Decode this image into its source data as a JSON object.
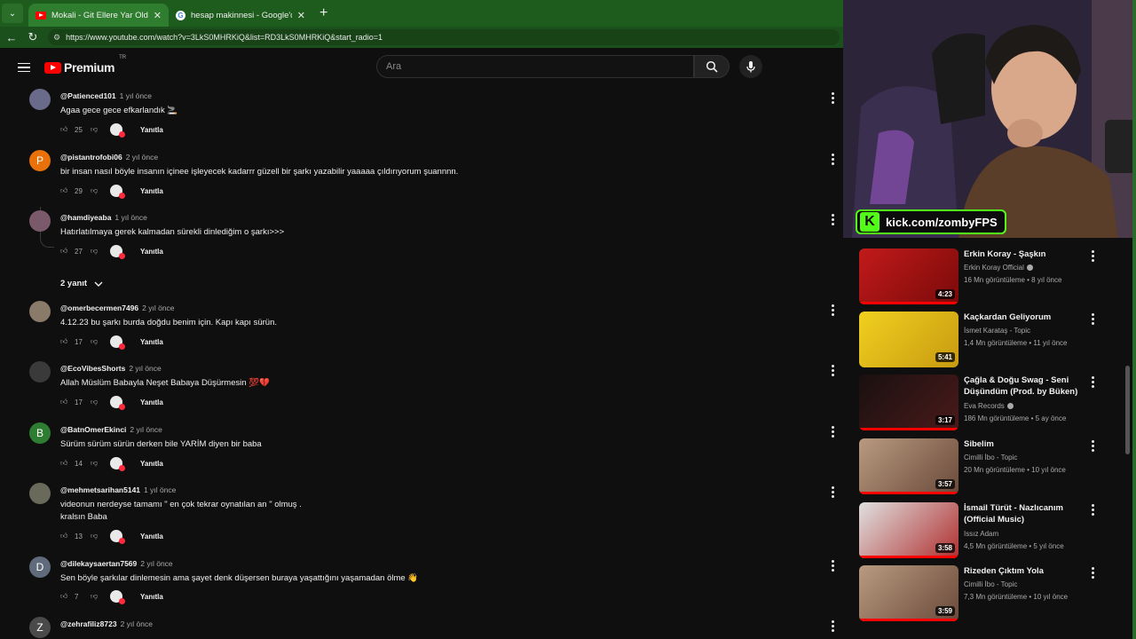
{
  "browser": {
    "tabs": [
      {
        "label": "Mokali - Git Ellere Yar Olda Git #bi",
        "active": true
      },
      {
        "label": "hesap makinnesi - Google'da Ara",
        "active": false
      }
    ],
    "new_tab": "+",
    "url": "https://www.youtube.com/watch?v=3LkS0MHRKiQ&list=RD3LkS0MHRKiQ&start_radio=1"
  },
  "youtube": {
    "logo_text": "Premium",
    "region": "TR",
    "search_placeholder": "Ara"
  },
  "comments": [
    {
      "author": "@Patienced101",
      "time": "1 yıl önce",
      "text": "Agaa gece gece efkarlandık 🚬",
      "likes": "25",
      "reply": "Yanıtla",
      "avatar_letter": "",
      "avatar_color": "#6a6a8a"
    },
    {
      "author": "@pistantrofobi06",
      "time": "2 yıl önce",
      "text": "bir insan nasıl böyle insanın içinee işleyecek kadarrr güzell bir şarkı yazabilir yaaaaa çıldırıyorum şuannnn.",
      "likes": "29",
      "reply": "Yanıtla",
      "avatar_letter": "P",
      "avatar_color": "#e8710a"
    },
    {
      "author": "@hamdiyeaba",
      "time": "1 yıl önce",
      "text": "Hatırlatılmaya gerek kalmadan sürekli dinlediğim o şarkı>>>",
      "likes": "27",
      "reply": "Yanıtla",
      "avatar_letter": "",
      "avatar_color": "#7a5a6a"
    },
    {
      "author": "@omerbecermen7496",
      "time": "2 yıl önce",
      "text": "4.12.23 bu şarkı burda doğdu benim için. Kapı kapı sürün.",
      "likes": "17",
      "reply": "Yanıtla",
      "avatar_letter": "",
      "avatar_color": "#8a7a6a"
    },
    {
      "author": "@EcoVibesShorts",
      "time": "2 yıl önce",
      "text": "Allah Müslüm Babayla Neşet Babaya Düşürmesin 💯💔",
      "likes": "17",
      "reply": "Yanıtla",
      "avatar_letter": "",
      "avatar_color": "#3a3a3a"
    },
    {
      "author": "@BatnOmerEkinci",
      "time": "2 yıl önce",
      "text": "Sürüm sürüm sürün derken bile YARİM diyen bir baba",
      "likes": "14",
      "reply": "Yanıtla",
      "avatar_letter": "B",
      "avatar_color": "#2e7d32"
    },
    {
      "author": "@mehmetsarihan5141",
      "time": "1 yıl önce",
      "text": "videonun nerdeyse tamamı \" en çok tekrar oynatılan an \" olmuş .\nkralsın Baba",
      "likes": "13",
      "reply": "Yanıtla",
      "avatar_letter": "",
      "avatar_color": "#6a6a5a"
    },
    {
      "author": "@dilekaysaertan7569",
      "time": "2 yıl önce",
      "text": "Sen böyle şarkılar dinlemesin ama şayet denk düşersen buraya yaşattığını yaşamadan ölme 👋",
      "likes": "7",
      "reply": "Yanıtla",
      "avatar_letter": "D",
      "avatar_color": "#5f6b7a"
    },
    {
      "author": "@zehrafiliz8723",
      "time": "2 yıl önce",
      "text": "",
      "likes": "",
      "reply": "",
      "avatar_letter": "Z",
      "avatar_color": "#4a4a4a"
    }
  ],
  "replies_toggle": "2 yanıt",
  "overlay": {
    "kick_text": "kick.com/zombyFPS",
    "kick_logo": "K"
  },
  "recommendations": [
    {
      "title": "Erkin Koray - Şaşkın",
      "channel": "Erkin Koray Official",
      "verified": true,
      "meta": "16 Mn görüntüleme • 8 yıl önce",
      "duration": "4:23",
      "thumb_color": "#c21a1a"
    },
    {
      "title": "Kaçkardan Geliyorum",
      "channel": "İsmet Karataş - Topic",
      "verified": false,
      "meta": "1,4 Mn görüntüleme • 11 yıl önce",
      "duration": "5:41",
      "thumb_color": "#e8c215"
    },
    {
      "title": "Çağla & Doğu Swag - Seni Düşündüm (Prod. by Büken)",
      "channel": "Eva Records",
      "verified": true,
      "meta": "186 Mn görüntüleme • 5 ay önce",
      "duration": "3:17",
      "thumb_color": "#3a1a1a"
    },
    {
      "title": "Sibelim",
      "channel": "Cimilli İbo - Topic",
      "verified": false,
      "meta": "20 Mn görüntüleme • 10 yıl önce",
      "duration": "3:57",
      "thumb_color": "#8a7060"
    },
    {
      "title": "İsmail Türüt - Nazlıcanım (Official Music)",
      "channel": "Issız Adam",
      "verified": false,
      "meta": "4,5 Mn görüntüleme • 5 yıl önce",
      "duration": "3:58",
      "thumb_color": "#b03030"
    },
    {
      "title": "Rizeden Çıktım Yola",
      "channel": "Cimilli İbo - Topic",
      "verified": false,
      "meta": "7,3 Mn görüntüleme • 10 yıl önce",
      "duration": "3:59",
      "thumb_color": "#8a7060"
    }
  ]
}
